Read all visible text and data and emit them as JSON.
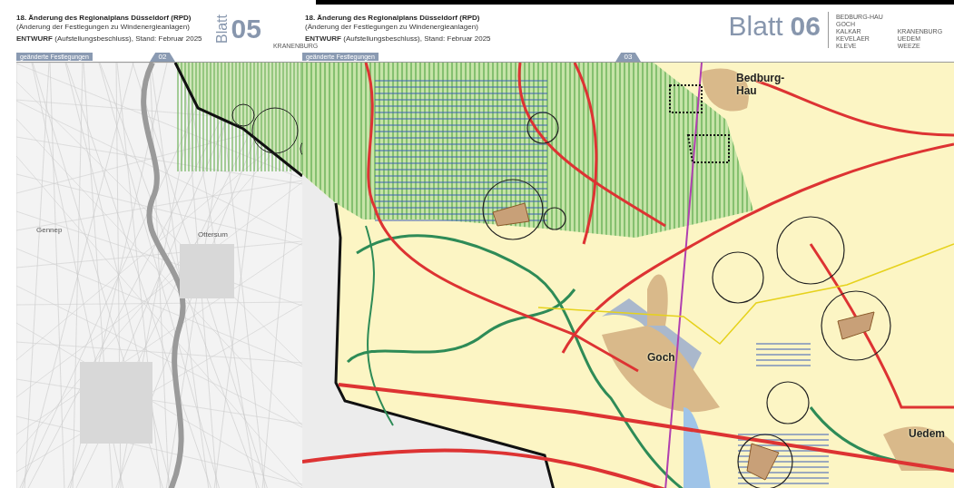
{
  "pages": [
    {
      "kind": "left",
      "title": "18. Änderung des Regionalplans Düsseldorf (RPD)",
      "subtitle": "(Änderung der Festlegungen zu Windenergieanlagen)",
      "status": "**ENTWURF** (Aufstellungsbeschluss), Stand: Februar 2025",
      "sheet_word": "Blatt",
      "sheet_number": "05",
      "municipalities": [
        [
          "KRANENBURG"
        ]
      ],
      "tab": "geänderte Festlegungen",
      "marker": "02",
      "map": {
        "kind": "topographic",
        "labels": [
          "Gennep",
          "Ottersum"
        ]
      }
    },
    {
      "kind": "right",
      "title": "18. Änderung des Regionalplans Düsseldorf (RPD)",
      "subtitle": "(Änderung der Festlegungen zu Windenergieanlagen)",
      "status": "**ENTWURF** (Aufstellungsbeschluss), Stand: Februar 2025",
      "sheet_word": "Blatt",
      "sheet_number": "06",
      "municipalities": [
        [
          "BEDBURG-HAU",
          "GOCH",
          "KALKAR",
          "KEVELAER",
          "KLEVE"
        ],
        [
          "KRANENBURG",
          "UEDEM",
          "WEEZE"
        ]
      ],
      "tab": "geänderte Festlegungen",
      "marker": "03",
      "map": {
        "kind": "regional_plan",
        "labels": [
          "Bedburg-Hau",
          "Goch",
          "Uedem"
        ]
      }
    }
  ]
}
